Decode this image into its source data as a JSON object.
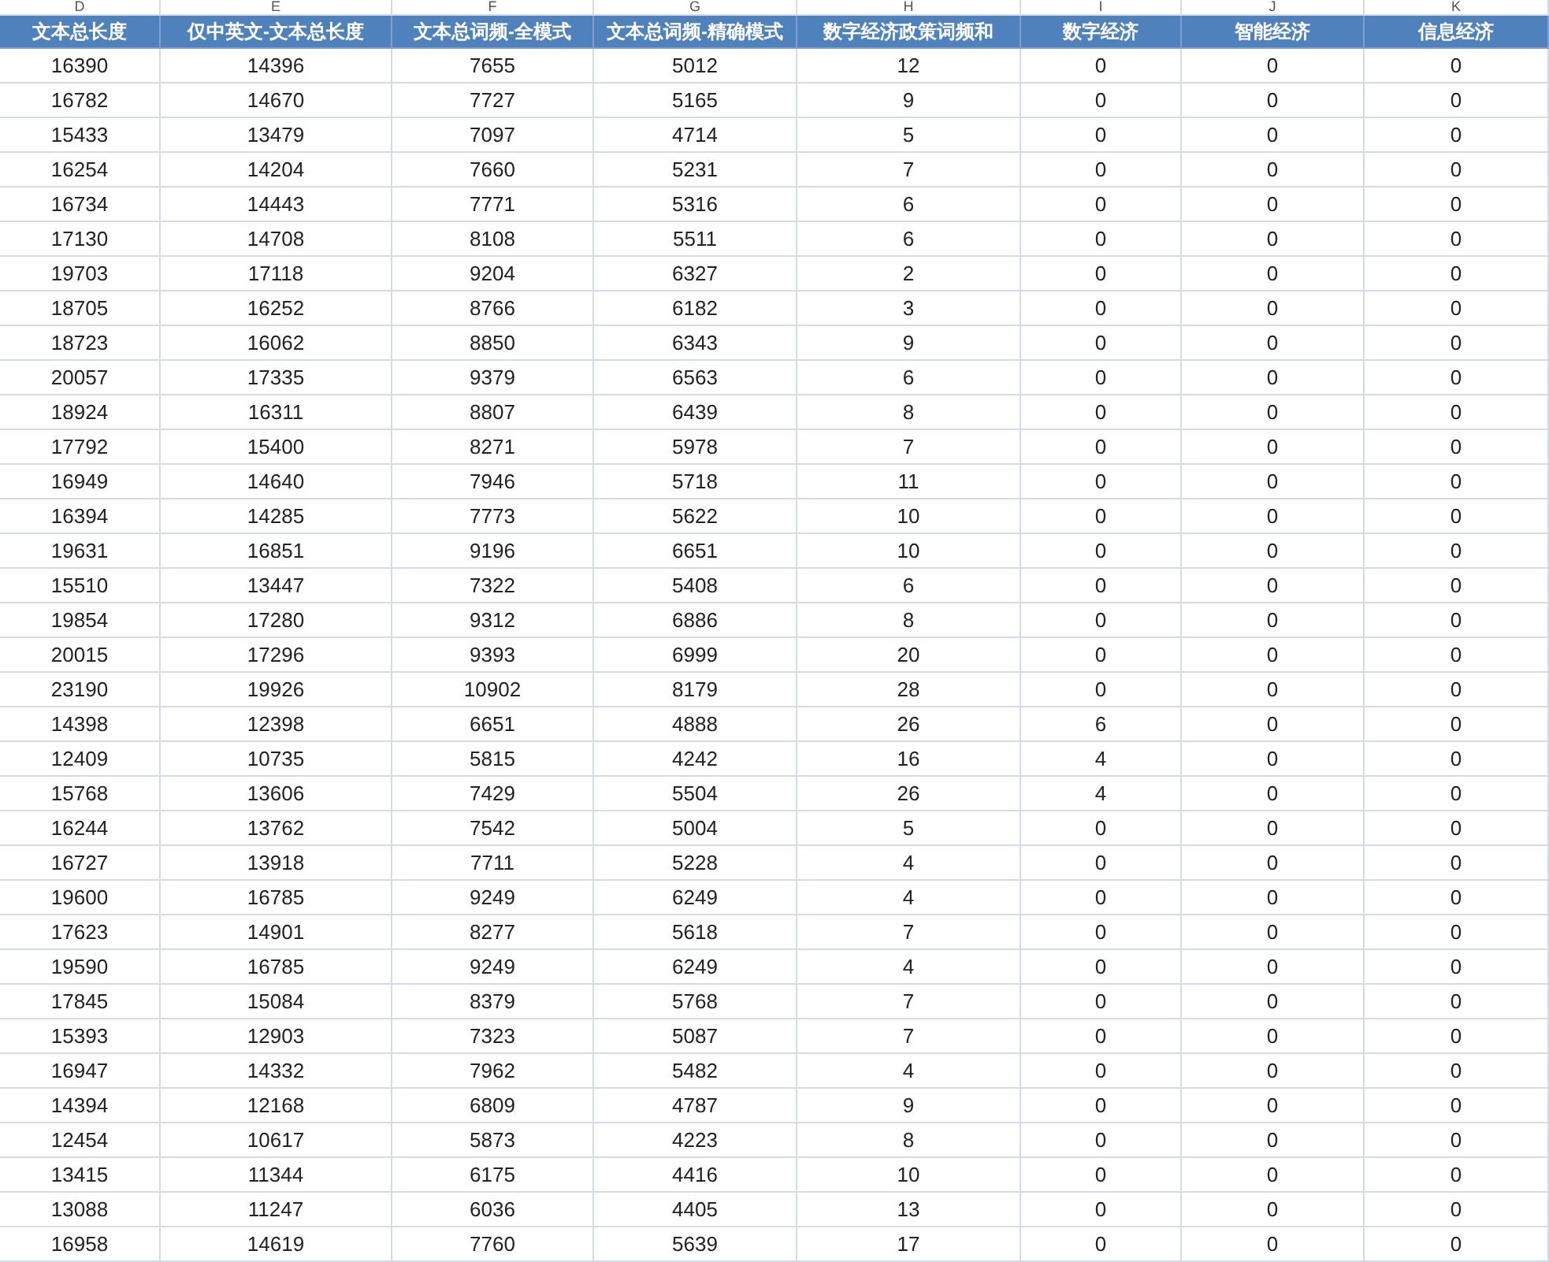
{
  "column_letters": [
    "D",
    "E",
    "F",
    "G",
    "H",
    "I",
    "J",
    "K"
  ],
  "columns": [
    "文本总长度",
    "仅中英文-文本总长度",
    "文本总词频-全模式",
    "文本总词频-精确模式",
    "数字经济政策词频和",
    "数字经济",
    "智能经济",
    "信息经济"
  ],
  "rows": [
    [
      "16390",
      "14396",
      "7655",
      "5012",
      "12",
      "0",
      "0",
      "0"
    ],
    [
      "16782",
      "14670",
      "7727",
      "5165",
      "9",
      "0",
      "0",
      "0"
    ],
    [
      "15433",
      "13479",
      "7097",
      "4714",
      "5",
      "0",
      "0",
      "0"
    ],
    [
      "16254",
      "14204",
      "7660",
      "5231",
      "7",
      "0",
      "0",
      "0"
    ],
    [
      "16734",
      "14443",
      "7771",
      "5316",
      "6",
      "0",
      "0",
      "0"
    ],
    [
      "17130",
      "14708",
      "8108",
      "5511",
      "6",
      "0",
      "0",
      "0"
    ],
    [
      "19703",
      "17118",
      "9204",
      "6327",
      "2",
      "0",
      "0",
      "0"
    ],
    [
      "18705",
      "16252",
      "8766",
      "6182",
      "3",
      "0",
      "0",
      "0"
    ],
    [
      "18723",
      "16062",
      "8850",
      "6343",
      "9",
      "0",
      "0",
      "0"
    ],
    [
      "20057",
      "17335",
      "9379",
      "6563",
      "6",
      "0",
      "0",
      "0"
    ],
    [
      "18924",
      "16311",
      "8807",
      "6439",
      "8",
      "0",
      "0",
      "0"
    ],
    [
      "17792",
      "15400",
      "8271",
      "5978",
      "7",
      "0",
      "0",
      "0"
    ],
    [
      "16949",
      "14640",
      "7946",
      "5718",
      "11",
      "0",
      "0",
      "0"
    ],
    [
      "16394",
      "14285",
      "7773",
      "5622",
      "10",
      "0",
      "0",
      "0"
    ],
    [
      "19631",
      "16851",
      "9196",
      "6651",
      "10",
      "0",
      "0",
      "0"
    ],
    [
      "15510",
      "13447",
      "7322",
      "5408",
      "6",
      "0",
      "0",
      "0"
    ],
    [
      "19854",
      "17280",
      "9312",
      "6886",
      "8",
      "0",
      "0",
      "0"
    ],
    [
      "20015",
      "17296",
      "9393",
      "6999",
      "20",
      "0",
      "0",
      "0"
    ],
    [
      "23190",
      "19926",
      "10902",
      "8179",
      "28",
      "0",
      "0",
      "0"
    ],
    [
      "14398",
      "12398",
      "6651",
      "4888",
      "26",
      "6",
      "0",
      "0"
    ],
    [
      "12409",
      "10735",
      "5815",
      "4242",
      "16",
      "4",
      "0",
      "0"
    ],
    [
      "15768",
      "13606",
      "7429",
      "5504",
      "26",
      "4",
      "0",
      "0"
    ],
    [
      "16244",
      "13762",
      "7542",
      "5004",
      "5",
      "0",
      "0",
      "0"
    ],
    [
      "16727",
      "13918",
      "7711",
      "5228",
      "4",
      "0",
      "0",
      "0"
    ],
    [
      "19600",
      "16785",
      "9249",
      "6249",
      "4",
      "0",
      "0",
      "0"
    ],
    [
      "17623",
      "14901",
      "8277",
      "5618",
      "7",
      "0",
      "0",
      "0"
    ],
    [
      "19590",
      "16785",
      "9249",
      "6249",
      "4",
      "0",
      "0",
      "0"
    ],
    [
      "17845",
      "15084",
      "8379",
      "5768",
      "7",
      "0",
      "0",
      "0"
    ],
    [
      "15393",
      "12903",
      "7323",
      "5087",
      "7",
      "0",
      "0",
      "0"
    ],
    [
      "16947",
      "14332",
      "7962",
      "5482",
      "4",
      "0",
      "0",
      "0"
    ],
    [
      "14394",
      "12168",
      "6809",
      "4787",
      "9",
      "0",
      "0",
      "0"
    ],
    [
      "12454",
      "10617",
      "5873",
      "4223",
      "8",
      "0",
      "0",
      "0"
    ],
    [
      "13415",
      "11344",
      "6175",
      "4416",
      "10",
      "0",
      "0",
      "0"
    ],
    [
      "13088",
      "11247",
      "6036",
      "4405",
      "13",
      "0",
      "0",
      "0"
    ],
    [
      "16958",
      "14619",
      "7760",
      "5639",
      "17",
      "0",
      "0",
      "0"
    ]
  ]
}
